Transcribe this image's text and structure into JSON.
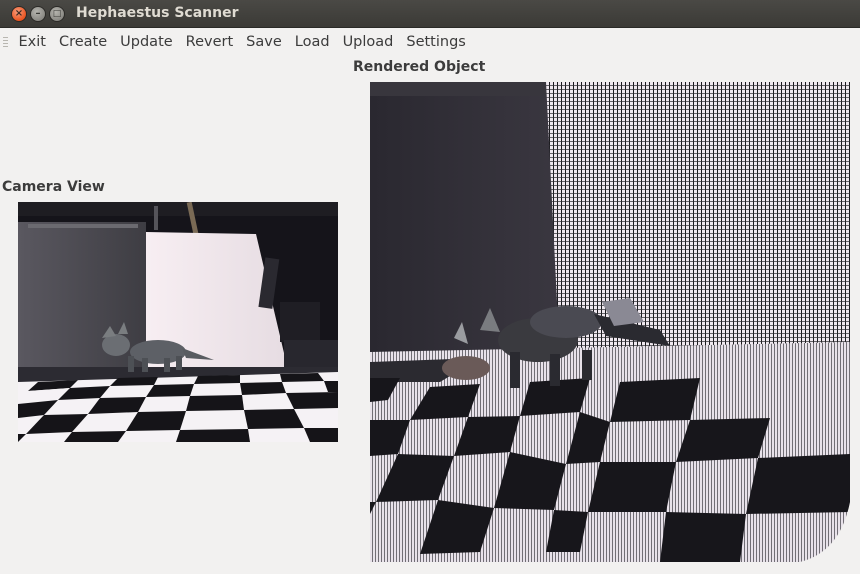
{
  "window": {
    "title": "Hephaestus Scanner",
    "buttons": {
      "close": "×",
      "minimize": "–",
      "maximize": "□"
    }
  },
  "menubar": {
    "items": [
      "Exit",
      "Create",
      "Update",
      "Revert",
      "Save",
      "Load",
      "Upload",
      "Settings"
    ]
  },
  "camera_view": {
    "label": "Camera View"
  },
  "rendered_object": {
    "label": "Rendered Object"
  },
  "colors": {
    "titlebar": "#3c3b37",
    "close_button": "#e95420",
    "window_background": "#f2f1f0"
  }
}
